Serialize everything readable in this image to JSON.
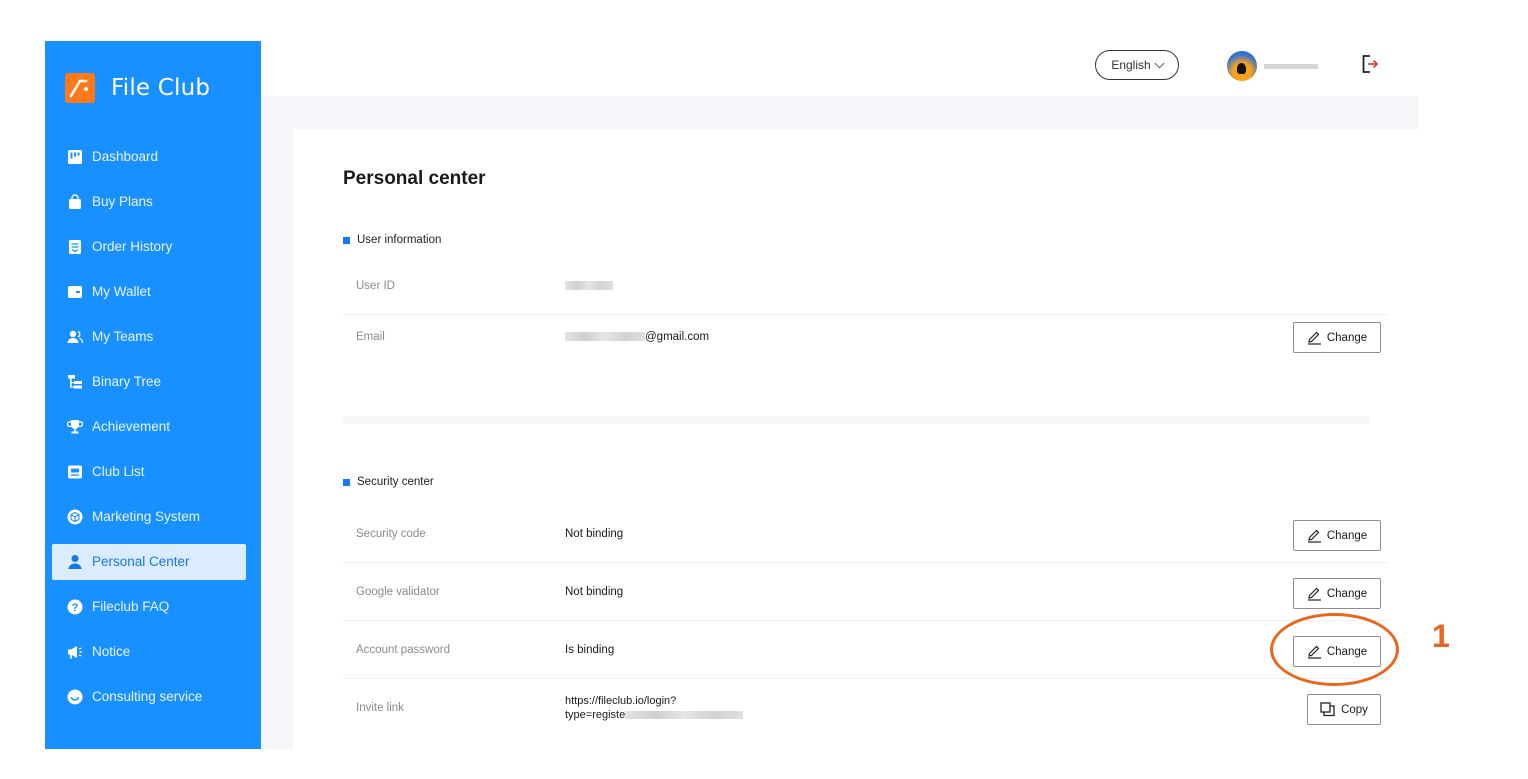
{
  "app": {
    "name": "File Club",
    "logo_icon": "file-club-logo-icon",
    "accent": "#1890ff",
    "brand_orange": "#ff7a1a"
  },
  "sidebar": {
    "items": [
      {
        "label": "Dashboard",
        "icon": "dashboard-icon",
        "active": false
      },
      {
        "label": "Buy Plans",
        "icon": "shopping-bag-icon",
        "active": false
      },
      {
        "label": "Order History",
        "icon": "order-list-icon",
        "active": false
      },
      {
        "label": "My Wallet",
        "icon": "wallet-icon",
        "active": false
      },
      {
        "label": "My Teams",
        "icon": "team-icon",
        "active": false
      },
      {
        "label": "Binary Tree",
        "icon": "tree-icon",
        "active": false
      },
      {
        "label": "Achievement",
        "icon": "trophy-icon",
        "active": false
      },
      {
        "label": "Club List",
        "icon": "club-list-icon",
        "active": false
      },
      {
        "label": "Marketing System",
        "icon": "cube-icon",
        "active": false
      },
      {
        "label": "Personal Center",
        "icon": "user-icon",
        "active": true
      },
      {
        "label": "Fileclub FAQ",
        "icon": "question-icon",
        "active": false
      },
      {
        "label": "Notice",
        "icon": "megaphone-icon",
        "active": false
      },
      {
        "label": "Consulting service",
        "icon": "chat-icon",
        "active": false
      }
    ]
  },
  "header": {
    "language": "English",
    "logout_icon": "logout-icon"
  },
  "main": {
    "title": "Personal center",
    "user_info": {
      "heading": "User information",
      "user_id_label": "User ID",
      "email_label": "Email",
      "email_suffix": "@gmail.com",
      "change_label": "Change"
    },
    "security": {
      "heading": "Security center",
      "rows": [
        {
          "label": "Security code",
          "value": "Not binding",
          "action": "Change"
        },
        {
          "label": "Google validator",
          "value": "Not binding",
          "action": "Change"
        },
        {
          "label": "Account password",
          "value": "Is binding",
          "action": "Change"
        }
      ],
      "invite": {
        "label": "Invite link",
        "line1": "https://fileclub.io/login?",
        "line2_prefix": "type=registe",
        "action": "Copy"
      }
    }
  },
  "annotation": {
    "number": "1",
    "color": "#e8661d"
  }
}
